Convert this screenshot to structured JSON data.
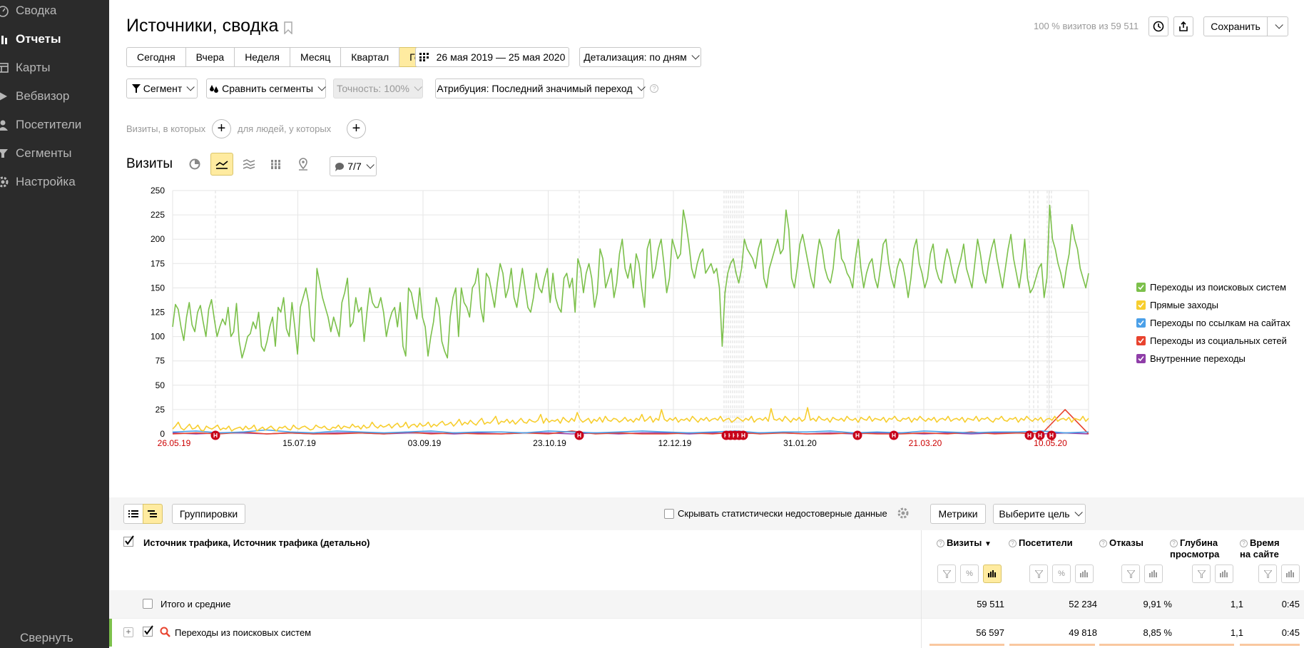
{
  "sidebar": {
    "items": [
      {
        "label": "Сводка",
        "icon": "gauge-icon"
      },
      {
        "label": "Отчеты",
        "icon": "bar-chart-icon",
        "active": true
      },
      {
        "label": "Карты",
        "icon": "map-layout-icon"
      },
      {
        "label": "Вебвизор",
        "icon": "play-icon"
      },
      {
        "label": "Посетители",
        "icon": "user-icon"
      },
      {
        "label": "Сегменты",
        "icon": "funnel-icon"
      },
      {
        "label": "Настройка",
        "icon": "gear-icon"
      }
    ],
    "collapse_label": "Свернуть"
  },
  "header": {
    "title": "Источники, сводка",
    "visits_share": "100 % визитов из 59 511",
    "save_label": "Сохранить"
  },
  "period": {
    "buttons": [
      "Сегодня",
      "Вчера",
      "Неделя",
      "Месяц",
      "Квартал",
      "Год"
    ],
    "active": "Год",
    "date_range": "26 мая 2019 — 25 мая 2020",
    "detail_label": "Детализация: по дням"
  },
  "segments": {
    "segment_label": "Сегмент",
    "compare_label": "Сравнить сегменты",
    "accuracy_label": "Точность: 100%",
    "attribution_label": "Атрибуция: Последний значимый переход"
  },
  "filters": {
    "visits_text": "Визиты, в которых",
    "people_text": "для людей, у которых"
  },
  "chart_section": {
    "title": "Визиты",
    "annotations_label": "7/7"
  },
  "chart_data": {
    "type": "line",
    "x_ticks": [
      "26.05.19",
      "15.07.19",
      "03.09.19",
      "23.10.19",
      "12.12.19",
      "31.01.20",
      "21.03.20",
      "10.05.20"
    ],
    "x_ticks_red": [
      "26.05.19",
      "21.03.20",
      "10.05.20"
    ],
    "ylim": [
      0,
      250
    ],
    "y_ticks": [
      0,
      25,
      50,
      75,
      100,
      125,
      150,
      175,
      200,
      225,
      250
    ],
    "grid": true,
    "legend_position": "right",
    "series": [
      {
        "name": "Переходы из поисковых систем",
        "color": "#7cc04b",
        "values": [
          110,
          133,
          128,
          110,
          96,
          120,
          135,
          112,
          105,
          125,
          132,
          115,
          100,
          128,
          138,
          118,
          100,
          110,
          118,
          112,
          130,
          100,
          105,
          134,
          95,
          78,
          88,
          100,
          103,
          115,
          108,
          125,
          90,
          85,
          95,
          110,
          120,
          90,
          130,
          125,
          140,
          108,
          100,
          135,
          110,
          82,
          130,
          140,
          150,
          135,
          100,
          95,
          170,
          155,
          140,
          130,
          120,
          105,
          120,
          110,
          100,
          135,
          145,
          160,
          110,
          115,
          140,
          125,
          130,
          95,
          125,
          150,
          135,
          130,
          130,
          140,
          125,
          100,
          115,
          125,
          130,
          110,
          135,
          90,
          80,
          150,
          145,
          130,
          118,
          150,
          120,
          110,
          80,
          100,
          115,
          140,
          130,
          95,
          85,
          78,
          120,
          140,
          150,
          100,
          150,
          135,
          130,
          120,
          150,
          155,
          170,
          130,
          115,
          165,
          160,
          145,
          130,
          155,
          175,
          165,
          140,
          150,
          170,
          140,
          130,
          150,
          170,
          150,
          130,
          125,
          140,
          165,
          150,
          145,
          160,
          170,
          135,
          165,
          140,
          130,
          125,
          160,
          165,
          150,
          160,
          125,
          180,
          170,
          145,
          165,
          175,
          160,
          130,
          145,
          190,
          180,
          150,
          160,
          170,
          140,
          155,
          185,
          200,
          170,
          160,
          175,
          150,
          185,
          175,
          150,
          130,
          190,
          200,
          160,
          170,
          190,
          200,
          175,
          145,
          160,
          200,
          190,
          180,
          185,
          230,
          215,
          195,
          170,
          160,
          175,
          185,
          190,
          165,
          170,
          175,
          165,
          170,
          150,
          90,
          145,
          165,
          175,
          180,
          165,
          155,
          170,
          200,
          190,
          185,
          180,
          170,
          190,
          200,
          160,
          150,
          170,
          180,
          190,
          200,
          185,
          190,
          230,
          210,
          160,
          150,
          170,
          195,
          205,
          190,
          175,
          160,
          150,
          180,
          200,
          190,
          170,
          160,
          155,
          170,
          200,
          210,
          180,
          175,
          165,
          160,
          150,
          180,
          200,
          170,
          150,
          165,
          175,
          180,
          160,
          150,
          170,
          195,
          200,
          175,
          160,
          150,
          170,
          180,
          175,
          160,
          140,
          160,
          190,
          200,
          175,
          165,
          150,
          160,
          185,
          195,
          170,
          160,
          155,
          175,
          190,
          180,
          165,
          155,
          170,
          180,
          195,
          170,
          160,
          150,
          175,
          200,
          185,
          165,
          155,
          175,
          190,
          200,
          180,
          165,
          150,
          170,
          190,
          205,
          180,
          165,
          150,
          170,
          200,
          160,
          145,
          150,
          160,
          170,
          175,
          140,
          160,
          235,
          200,
          190,
          175,
          165,
          150,
          170,
          185,
          215,
          200,
          190,
          170,
          160,
          150,
          165
        ]
      },
      {
        "name": "Прямые заходы",
        "color": "#f7ce2f",
        "values": [
          5,
          8,
          12,
          6,
          4,
          7,
          10,
          5,
          6,
          9,
          4,
          3,
          8,
          6,
          5,
          7,
          9,
          4,
          6,
          5,
          8,
          3,
          5,
          6,
          7,
          4,
          8,
          5,
          6,
          9,
          3,
          5,
          7,
          4,
          6,
          8,
          5,
          3,
          7,
          6,
          8,
          5,
          4,
          9,
          6,
          5,
          7,
          8,
          6,
          4,
          5,
          9,
          7,
          6,
          8,
          5,
          4,
          7,
          6,
          9,
          5,
          8,
          7,
          6,
          10,
          7,
          8,
          5,
          9,
          6,
          7,
          12,
          8,
          6,
          9,
          7,
          8,
          10,
          6,
          9,
          11,
          7,
          8,
          12,
          6,
          9,
          10,
          7,
          11,
          8,
          9,
          12,
          7,
          10,
          8,
          11,
          13,
          9,
          10,
          12,
          8,
          11,
          15,
          9,
          12,
          10,
          14,
          11,
          9,
          13,
          16,
          10,
          12,
          11,
          14,
          18,
          10,
          13,
          12,
          15,
          11,
          14,
          10,
          13,
          16,
          12,
          11,
          15,
          13,
          12,
          14,
          20,
          11,
          16,
          12,
          14,
          13,
          15,
          11,
          17,
          14,
          12,
          16,
          13,
          22,
          15,
          12,
          14,
          16,
          11,
          15,
          13,
          17,
          12,
          18,
          14,
          13,
          16,
          15,
          12,
          14,
          17,
          13,
          15,
          12,
          16,
          14,
          20,
          13,
          15,
          18,
          12,
          16,
          14,
          25,
          15,
          13,
          16,
          14,
          17,
          12,
          15,
          14,
          16,
          13,
          18,
          15,
          12,
          16,
          14,
          17,
          13,
          15,
          16,
          14,
          18,
          13,
          15,
          16,
          12,
          14,
          17,
          15,
          13,
          16,
          14,
          18,
          12,
          15,
          16,
          14,
          17,
          13,
          26,
          15,
          14,
          16,
          13,
          18,
          15,
          12,
          16,
          14,
          17,
          13,
          15,
          27,
          14,
          16,
          13,
          18,
          15,
          14,
          16,
          12,
          17,
          15,
          14,
          16,
          13,
          18,
          15,
          14,
          16,
          12,
          17,
          15,
          14,
          18,
          13,
          16,
          15,
          14,
          17,
          12,
          16,
          15,
          18,
          14,
          13,
          16,
          15,
          17,
          12,
          16,
          14,
          18,
          15,
          13,
          16,
          14,
          17,
          12,
          15,
          16,
          14,
          18,
          13,
          15,
          16,
          14,
          17,
          12,
          16,
          15,
          14,
          18,
          13,
          16,
          15,
          17,
          14,
          12,
          16,
          15,
          18,
          14,
          13,
          16,
          15,
          17,
          12,
          16,
          14,
          18,
          15,
          13,
          16,
          14,
          17,
          12,
          15,
          16,
          14,
          18,
          13,
          15,
          16,
          14,
          17,
          12,
          16,
          15,
          14,
          18,
          13,
          16
        ]
      },
      {
        "name": "Переходы по ссылкам на сайтах",
        "color": "#4ba0e8",
        "values": [
          2,
          3,
          1,
          2,
          4,
          2,
          1,
          3,
          2,
          1,
          2,
          3,
          1,
          2,
          2,
          1,
          3,
          2,
          1,
          2,
          3,
          2,
          1,
          2,
          3,
          1,
          2,
          2,
          3,
          1,
          2,
          1,
          3,
          2,
          1,
          2,
          2,
          3,
          1,
          2
        ]
      },
      {
        "name": "Переходы из социальных сетей",
        "color": "#e8432e",
        "values": [
          0,
          1,
          0,
          2,
          0,
          1,
          0,
          0,
          1,
          0,
          2,
          0,
          1,
          0,
          0,
          1,
          0,
          3,
          0,
          1,
          0,
          0,
          1,
          0,
          2,
          0,
          1,
          0,
          0,
          1,
          0,
          0,
          1,
          0,
          2,
          0,
          1,
          0,
          25,
          0
        ]
      },
      {
        "name": "Внутренние переходы",
        "color": "#8f3ea8",
        "values": [
          1,
          0,
          1,
          1,
          0,
          1,
          0,
          1,
          1,
          0,
          1,
          1,
          0,
          1,
          0,
          1,
          1,
          0,
          1,
          0,
          1,
          1,
          0,
          1,
          0,
          1,
          1,
          0,
          1,
          0,
          1,
          1,
          0,
          1,
          0,
          1,
          1,
          0,
          1,
          0
        ]
      }
    ]
  },
  "table": {
    "groupings_label": "Группировки",
    "hide_unreliable_label": "Скрывать статистически недостоверные данные",
    "metrics_label": "Метрики",
    "goal_label": "Выберите цель",
    "dimension_header": "Источник трафика, Источник трафика (детально)",
    "columns": [
      {
        "label": "Визиты",
        "sort": "▼"
      },
      {
        "label": "Посетители"
      },
      {
        "label": "Отказы"
      },
      {
        "label": "Глубина просмотра"
      },
      {
        "label": "Время на сайте"
      }
    ],
    "total_row": {
      "label": "Итого и средние",
      "values": [
        "59 511",
        "52 234",
        "9,91 %",
        "1,1",
        "0:45"
      ]
    },
    "rows": [
      {
        "label": "Переходы из поисковых систем",
        "values": [
          "56 597",
          "49 818",
          "8,85 %",
          "1,1",
          "0:45"
        ]
      }
    ]
  }
}
